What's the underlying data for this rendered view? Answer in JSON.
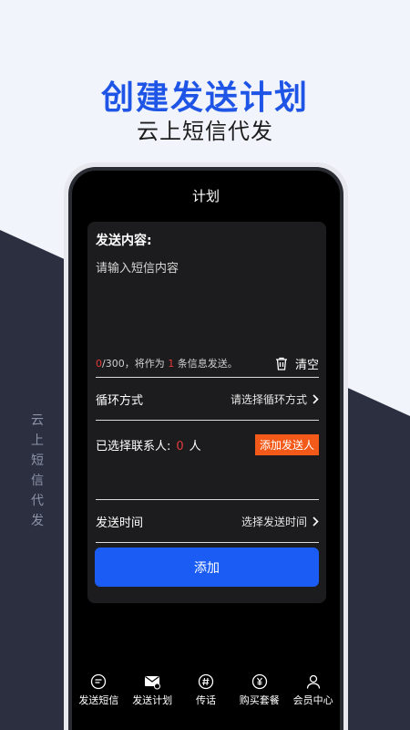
{
  "poster": {
    "headline": "创建发送计划",
    "subheadline": "云上短信代发",
    "side_text": [
      "云",
      "上",
      "短",
      "信",
      "代",
      "发"
    ]
  },
  "screen": {
    "title": "计划",
    "content": {
      "label": "发送内容:",
      "placeholder": "请输入短信内容",
      "char_count": "0",
      "char_limit_text": "/300，将作为",
      "message_count": "1",
      "message_suffix": "条信息发送。",
      "clear_label": "清空"
    },
    "cycle": {
      "label": "循环方式",
      "value": "请选择循环方式"
    },
    "contacts": {
      "label": "已选择联系人:",
      "count": "0",
      "unit": "人",
      "add_label": "添加发送人"
    },
    "send_time": {
      "label": "发送时间",
      "value": "选择发送时间"
    },
    "submit_label": "添加"
  },
  "tabs": [
    {
      "label": "发送短信",
      "icon": "message-icon"
    },
    {
      "label": "发送计划",
      "icon": "mail-icon"
    },
    {
      "label": "传话",
      "icon": "hashtag-icon"
    },
    {
      "label": "购买套餐",
      "icon": "currency-icon"
    },
    {
      "label": "会员中心",
      "icon": "user-icon"
    }
  ],
  "colors": {
    "accent": "#1b5cf5",
    "headline": "#1f55e6",
    "warning": "#f35a1a",
    "highlight": "#e23b3b",
    "background": "#f1f4fb",
    "dark_panel": "#2b2f40"
  }
}
